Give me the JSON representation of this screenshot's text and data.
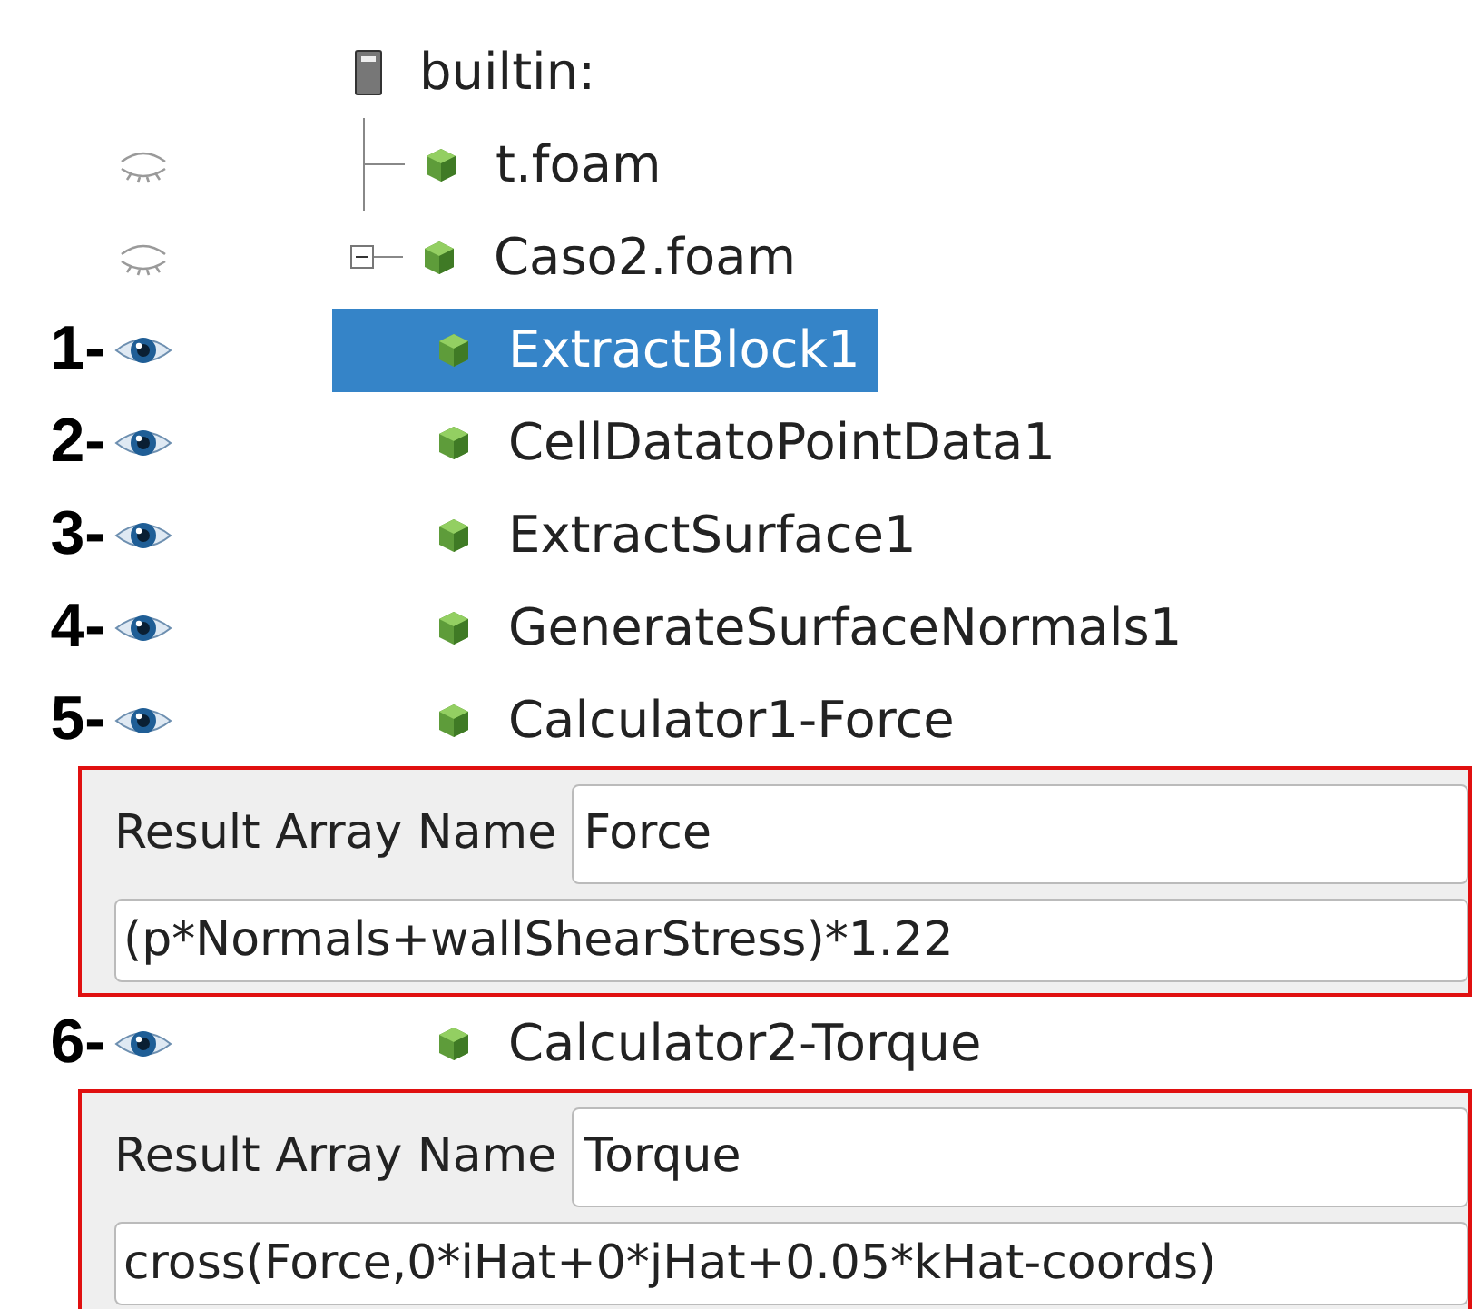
{
  "root": {
    "name": "builtin:",
    "children": [
      {
        "name": "t.foam",
        "visible": false,
        "selected": false,
        "expanded": false
      },
      {
        "name": "Caso2.foam",
        "visible": false,
        "selected": false,
        "expanded": true,
        "children": [
          {
            "marker": "1-",
            "name": "ExtractBlock1",
            "visible": true,
            "selected": true
          },
          {
            "marker": "2-",
            "name": "CellDatatoPointData1",
            "visible": true,
            "selected": false
          },
          {
            "marker": "3-",
            "name": "ExtractSurface1",
            "visible": true,
            "selected": false
          },
          {
            "marker": "4-",
            "name": "GenerateSurfaceNormals1",
            "visible": true,
            "selected": false
          },
          {
            "marker": "5-",
            "name": "Calculator1-Force",
            "visible": true,
            "selected": false,
            "properties": {
              "label": "Result Array Name",
              "value": "Force",
              "expression": "(p*Normals+wallShearStress)*1.22"
            }
          },
          {
            "marker": "6-",
            "name": "Calculator2-Torque",
            "visible": true,
            "selected": false,
            "properties": {
              "label": "Result Array Name",
              "value": "Torque",
              "expression": "cross(Force,0*iHat+0*jHat+0.05*kHat-coords)"
            }
          }
        ]
      }
    ]
  }
}
